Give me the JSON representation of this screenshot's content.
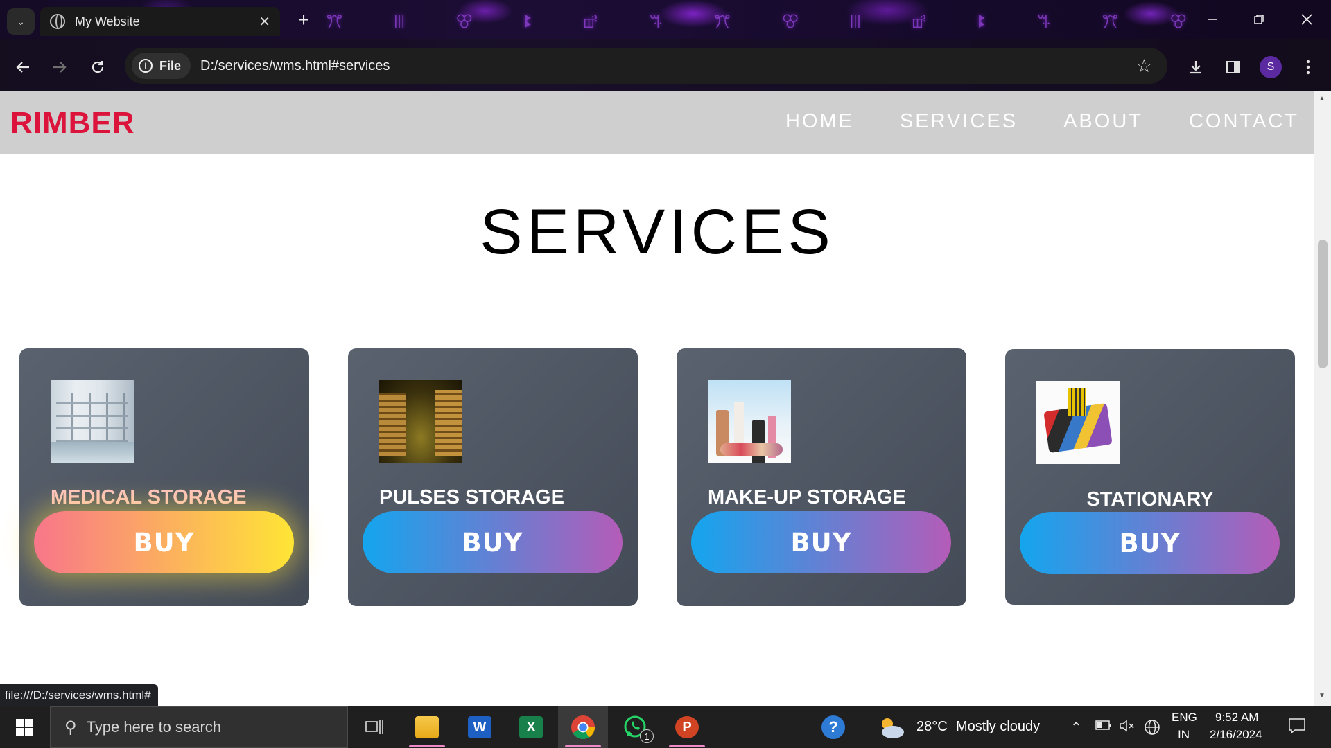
{
  "browser": {
    "tab_title": "My Website",
    "tab_close": "✕",
    "new_tab": "+",
    "file_chip": "File",
    "url": "D:/services/wms.html#services",
    "status_link": "file:///D:/services/wms.html#",
    "profile_initial": "S"
  },
  "site": {
    "brand": "RIMBER",
    "nav": [
      "HOME",
      "SERVICES",
      "ABOUT",
      "CONTACT"
    ],
    "section_title": "SERVICES",
    "cards": [
      {
        "name": "MEDICAL STORAGE",
        "button": "BUY",
        "image": "warehouse-shelves-image"
      },
      {
        "name": "PULSES STORAGE",
        "button": "BUY",
        "image": "grain-warehouse-image"
      },
      {
        "name": "MAKE-UP STORAGE",
        "button": "BUY",
        "image": "cosmetics-image"
      },
      {
        "name": "STATIONARY",
        "button": "BUY",
        "image": "stationery-items-image"
      }
    ],
    "colors": {
      "brand": "#dc143c",
      "navbar_bg": "#cfcfcf",
      "card_bg": "#4f5662",
      "button_gradient": [
        "#14a5ee",
        "#b45cb8"
      ],
      "button_hover_gradient": [
        "#f8768a",
        "#ffe535"
      ]
    }
  },
  "taskbar": {
    "search_placeholder": "Type here to search",
    "whatsapp_badge": "1",
    "weather_temp": "28°C",
    "weather_text": "Mostly cloudy",
    "lang_top": "ENG",
    "lang_bottom": "IN",
    "time": "9:52 AM",
    "date": "2/16/2024"
  }
}
